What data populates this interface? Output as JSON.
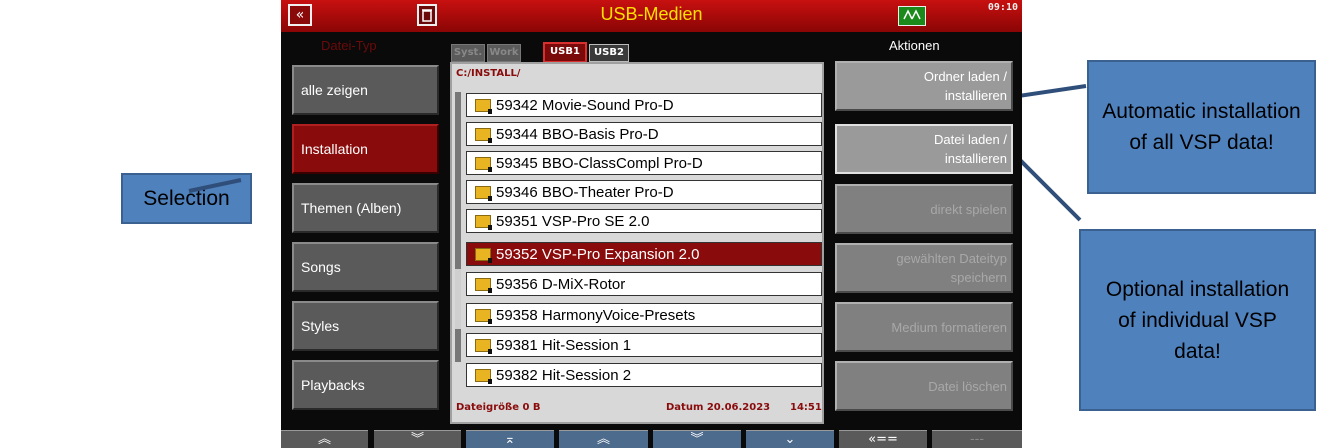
{
  "topbar": {
    "title": "USB-Medien",
    "back_icon": "«",
    "clock": "09:10"
  },
  "left": {
    "header": "Datei-Typ",
    "items": [
      {
        "label": "alle zeigen",
        "active": false
      },
      {
        "label": "Installation",
        "active": true
      },
      {
        "label": "Themen (Alben)",
        "active": false
      },
      {
        "label": "Songs",
        "active": false
      },
      {
        "label": "Styles",
        "active": false
      },
      {
        "label": "Playbacks",
        "active": false
      }
    ]
  },
  "tabs": [
    {
      "label": "Syst.",
      "state": "disabled"
    },
    {
      "label": "Work",
      "state": "disabled"
    },
    {
      "label": "USB1",
      "state": "active"
    },
    {
      "label": "USB2",
      "state": "normal"
    }
  ],
  "filebrowser": {
    "path": "C:/INSTALL/",
    "rows": [
      "59342 Movie-Sound Pro-D",
      "59344 BBO-Basis Pro-D",
      "59345 BBO-ClassCompl Pro-D",
      "59346 BBO-Theater Pro-D",
      "59351 VSP-Pro SE 2.0",
      "59352 VSP-Pro Expansion 2.0",
      "59356 D-MiX-Rotor",
      "59358 HarmonyVoice-Presets",
      "59381 Hit-Session 1",
      "59382 Hit-Session 2"
    ],
    "selected_index": 5,
    "size_label": "Dateigröße 0 B",
    "date_label": "Datum 20.06.2023",
    "time_label": "14:51"
  },
  "right": {
    "header": "Aktionen",
    "buttons": [
      {
        "line1": "Ordner laden /",
        "line2": "installieren",
        "enabled": true
      },
      {
        "line1": "Datei laden /",
        "line2": "installieren",
        "enabled": true
      },
      {
        "line1": "direkt spielen",
        "line2": "",
        "enabled": false
      },
      {
        "line1": "gewählten Dateityp",
        "line2": "speichern",
        "enabled": false
      },
      {
        "line1": "Medium formatieren",
        "line2": "",
        "enabled": false
      },
      {
        "line1": "Datei löschen",
        "line2": "",
        "enabled": false
      }
    ]
  },
  "bottom": [
    {
      "label": "≈",
      "icon": "double-chevron-up-icon"
    },
    {
      "label": "≈",
      "icon": "double-chevron-down-icon"
    },
    {
      "label": "⌅",
      "icon": "scroll-top-icon"
    },
    {
      "label": "≈",
      "icon": "double-chevron-up-icon"
    },
    {
      "label": "≈",
      "icon": "double-chevron-down-icon"
    },
    {
      "label": "⌄",
      "icon": "scroll-bottom-icon"
    },
    {
      "label": "«==",
      "icon": "back-arrow-icon"
    },
    {
      "label": "---",
      "icon": "none"
    }
  ],
  "callouts": {
    "selection": "Selection",
    "automatic": "Automatic installation of all VSP data!",
    "optional": "Optional installation of individual VSP data!"
  },
  "colors": {
    "accent_red": "#8a0b0b",
    "title_yellow": "#ffe000",
    "callout_blue": "#4f81bd"
  }
}
